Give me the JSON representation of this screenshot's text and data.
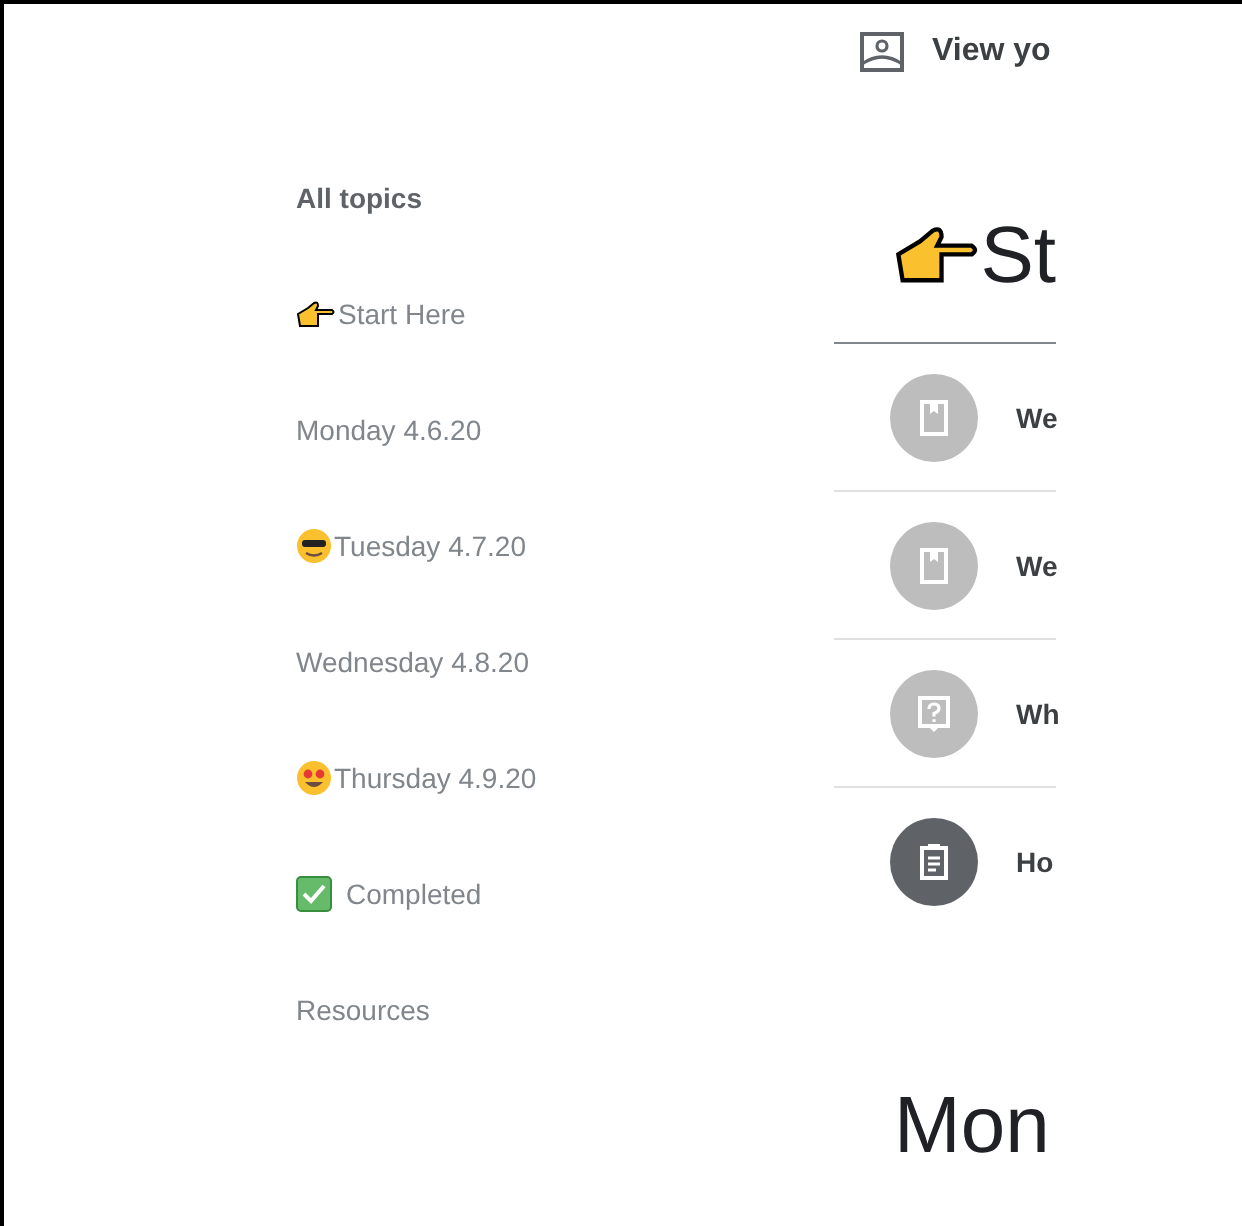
{
  "header_link": {
    "label": "View yo"
  },
  "sidebar": {
    "title": "All topics",
    "items": [
      {
        "label": "Start Here",
        "kind": "hand"
      },
      {
        "label": "Monday 4.6.20",
        "kind": "plain"
      },
      {
        "label": "Tuesday 4.7.20",
        "kind": "cool"
      },
      {
        "label": "Wednesday 4.8.20",
        "kind": "plain"
      },
      {
        "label": "Thursday 4.9.20",
        "kind": "love"
      },
      {
        "label": "Completed",
        "kind": "check"
      },
      {
        "label": "Resources",
        "kind": "plain"
      }
    ]
  },
  "topic": {
    "title": "St",
    "items": [
      {
        "title": "We",
        "kind": "material"
      },
      {
        "title": "We",
        "kind": "material"
      },
      {
        "title": "Wh",
        "kind": "question"
      },
      {
        "title": "Ho",
        "kind": "assignment"
      }
    ]
  },
  "next_topic": {
    "title": "Mon"
  }
}
